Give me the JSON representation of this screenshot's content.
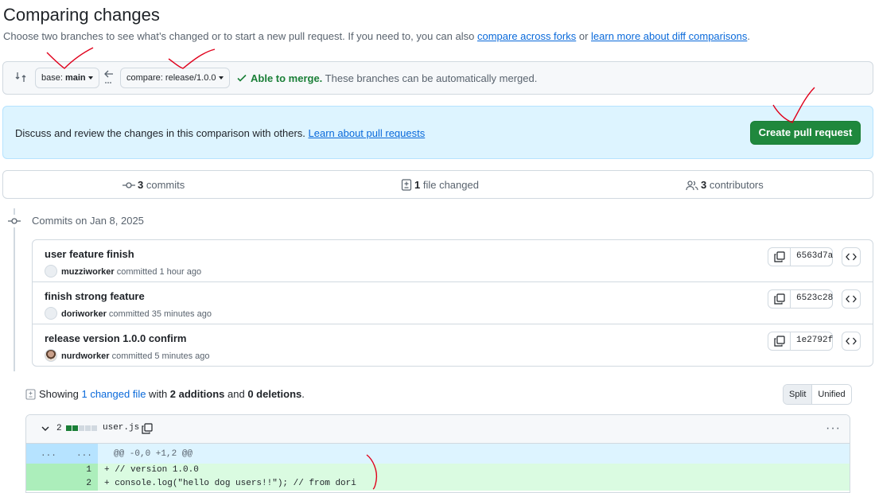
{
  "page": {
    "title": "Comparing changes",
    "subtitle_text": "Choose two branches to see what’s changed or to start a new pull request. If you need to, you can also ",
    "compare_forks_link": "compare across forks",
    "or_text": " or ",
    "learn_diff_link": "learn more about diff comparisons",
    "period": "."
  },
  "branch_bar": {
    "base_label": "base: ",
    "base_branch": "main",
    "compare_label": "compare: ",
    "compare_branch": "release/1.0.0",
    "merge_ok": "Able to merge.",
    "merge_text": " These branches can be automatically merged."
  },
  "info": {
    "text": "Discuss and review the changes in this comparison with others. ",
    "link": "Learn about pull requests",
    "create_button": "Create pull request"
  },
  "stats": {
    "commits_count": "3",
    "commits_label": " commits",
    "files_count": "1",
    "files_label": " file changed",
    "contributors_count": "3",
    "contributors_label": " contributors"
  },
  "commits_header": "Commits on Jan 8, 2025",
  "commits": [
    {
      "message": "user feature finish",
      "author": "muzziworker",
      "action": " committed ",
      "time": "1 hour ago",
      "sha": "6563d7a"
    },
    {
      "message": "finish strong feature",
      "author": "doriworker",
      "action": " committed ",
      "time": "35 minutes ago",
      "sha": "6523c28"
    },
    {
      "message": "release version 1.0.0 confirm",
      "author": "nurdworker",
      "action": " committed ",
      "time": "5 minutes ago",
      "sha": "1e2792f"
    }
  ],
  "diff_summary": {
    "showing": "Showing ",
    "changed_link": "1 changed file",
    "with": " with ",
    "additions": "2 additions",
    "and": " and ",
    "deletions": "0 deletions",
    "period": "."
  },
  "view_toggle": {
    "split": "Split",
    "unified": "Unified"
  },
  "file": {
    "change_count": "2",
    "name": "user.js",
    "more": "···",
    "hunk_old": "...",
    "hunk_new": "...",
    "hunk_header": "@@ -0,0 +1,2 @@",
    "lines": [
      {
        "num": "1",
        "text": "+ // version 1.0.0"
      },
      {
        "num": "2",
        "text": "+ console.log(\"hello dog users!!\"); // from dori"
      }
    ]
  },
  "colors": {
    "accent_link": "#0969da",
    "create_button": "#1f883d",
    "merge_ok": "#1a7f37",
    "annotation": "#e0001b"
  }
}
